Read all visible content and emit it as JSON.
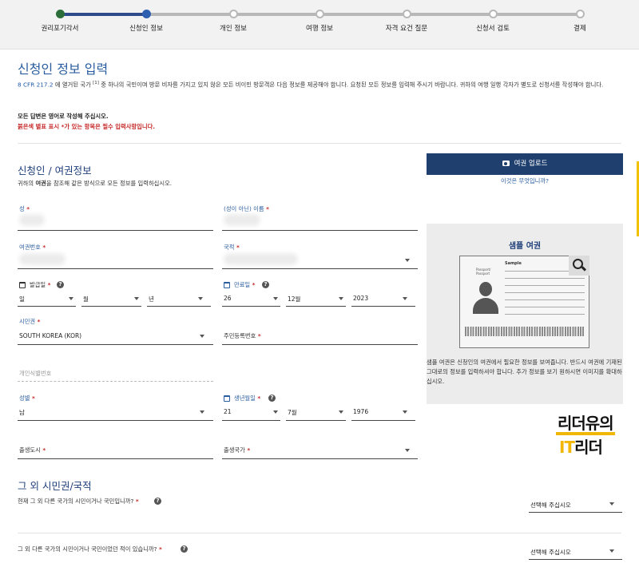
{
  "stepper": {
    "steps": [
      {
        "label": "권리포기각서",
        "state": "done"
      },
      {
        "label": "신청인 정보",
        "state": "active"
      },
      {
        "label": "개인 정보",
        "state": "todo"
      },
      {
        "label": "여행 정보",
        "state": "todo"
      },
      {
        "label": "자격 요건 질문",
        "state": "todo"
      },
      {
        "label": "신청서 검토",
        "state": "todo"
      },
      {
        "label": "결제",
        "state": "todo"
      }
    ]
  },
  "header": {
    "title": "신청인 정보 입력",
    "intro_ref": "8 CFR 217.2",
    "intro_text_a": " 에 열거된 국가 ",
    "intro_sup": "[1]",
    "intro_text_b": " 중 하나의 국민이며 방문 비자를 가지고 있지 않은 모든 비이민 방문객은 다음 정보를 제공해야 합니다. 요청된 모든 정보를 입력해 주시기 바랍니다. 귀하의 여행 일행 각자가 별도로 신청서를 작성해야 합니다.",
    "note_english": "모든 답변은 영어로 작성해 주십시오.",
    "note_required": "붉은색 별표 표시 *가 있는 항목은 필수 입력사항입니다."
  },
  "applicant": {
    "section_title": "신청인 / 여권정보",
    "section_sub_a": "귀하의 ",
    "section_sub_bold": "여권",
    "section_sub_b": "을 참조해 같은 방식으로 모든 정보를 입력하십시오.",
    "surname_label": "성",
    "given_name_label": "(성이 아닌) 이름",
    "passport_no_label": "여권번호",
    "nationality_label": "국적",
    "issue_date_label": "발급일",
    "issue_day": "일",
    "issue_month": "월",
    "issue_year": "년",
    "expiry_date_label": "만료일",
    "expiry_day": "26",
    "expiry_month": "12월",
    "expiry_year": "2023",
    "citizenship_label": "시민권",
    "citizenship_value": "SOUTH KOREA (KOR)",
    "resident_no_label": "주민등록번호",
    "personal_id_label": "개인식별번호",
    "gender_label": "성별",
    "gender_value": "남",
    "birth_date_label": "생년월일",
    "birth_day": "21",
    "birth_month": "7월",
    "birth_year": "1976",
    "birth_city_label": "출생도시",
    "birth_country_label": "출생국가",
    "required_mark": " *"
  },
  "upload": {
    "button_label": "여권 업로드",
    "what_link": "이것은 무엇입니까?"
  },
  "sample": {
    "title": "샘플 여권",
    "pp_heading": "Sample",
    "pp_side": "Passport/\nPassport",
    "description": "샘플 여권은 신청인의 여권에서 필요한 정보를 보여줍니다. 반드시 여권에 기재된 그대로의 정보를 입력하셔야 합니다. 추가 정보를 보기 원하시면 이미지를 확대하십시오."
  },
  "logo": {
    "line1": "리더유의",
    "line2_it": "IT",
    "line2_rest": "리더"
  },
  "other_citizenship": {
    "section_title": "그 외 시민권/국적",
    "q1": "현재 그 외 다른 국가의 시민이거나 국민입니까?",
    "q1_select": "선택해 주십시오",
    "q2": "그 외 다른 국가의 시민이거나 국민이었던 적이 있습니까?",
    "q2_select": "선택해 주십시오"
  },
  "colors": {
    "accent": "#1f3f6e",
    "label_blue": "#2a5d9f",
    "required_red": "#c62828",
    "step_done": "#2c6e3a"
  }
}
